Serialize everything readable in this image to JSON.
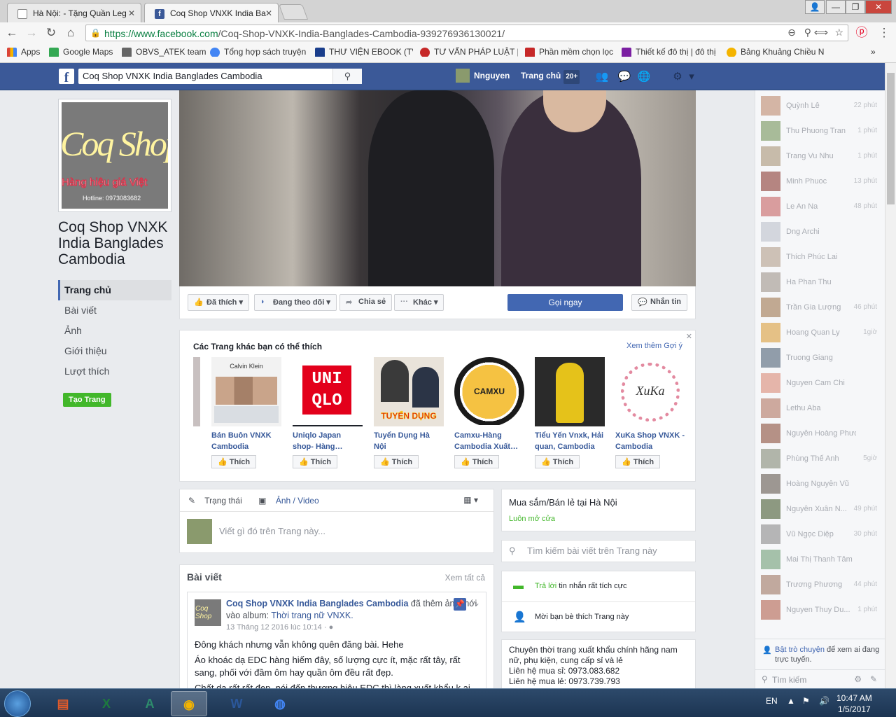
{
  "browser": {
    "tabs": [
      {
        "title": "Hà Nội: - Tặng Quần Leg"
      },
      {
        "title": "Coq Shop VNXK India Ba"
      }
    ],
    "url_host": "https://www.facebook.com",
    "url_path": "/Coq-Shop-VNXK-India-Banglades-Cambodia-939276936130021/",
    "bookmarks": [
      {
        "label": "Apps",
        "color": "#db4437"
      },
      {
        "label": "Google Maps",
        "color": "#34a853"
      },
      {
        "label": "OBVS_ATEK team",
        "color": "#666666"
      },
      {
        "label": "Tổng hợp sách truyện",
        "color": "#4285f4"
      },
      {
        "label": "THƯ VIỆN EBOOK (TV",
        "color": "#1a3e8c"
      },
      {
        "label": "TƯ VẤN PHÁP LUẬT |",
        "color": "#c62828"
      },
      {
        "label": "Phần mềm chọn lọc",
        "color": "#c62828"
      },
      {
        "label": "Thiết kế đô thị | đô thị",
        "color": "#7b1fa2"
      },
      {
        "label": "Bảng Khuảng Chiều N",
        "color": "#f4b400"
      }
    ]
  },
  "fb": {
    "search_value": "Coq Shop VNXK India Banglades Cambodia",
    "user_name": "Nnguyen",
    "home_label": "Trang chủ",
    "home_count": "20+"
  },
  "page": {
    "logo_text": "Coq Shop",
    "logo_tagline": "Hàng hiệu giá Việt",
    "logo_hotline": "Hotline: 0973083682",
    "name": "Coq Shop VNXK India Banglades Cambodia",
    "nav": [
      "Trang chủ",
      "Bài viết",
      "Ảnh",
      "Giới thiệu",
      "Lượt thích"
    ],
    "create_page": "Tạo Trang"
  },
  "actions": {
    "liked": "Đã thích",
    "following": "Đang theo dõi",
    "share": "Chia sẻ",
    "more": "Khác",
    "call": "Gọi ngay",
    "message": "Nhắn tin"
  },
  "suggest": {
    "title": "Các Trang khác bạn có thể thích",
    "more": "Xem thêm Gợi ý",
    "like_label": "Thích",
    "items": [
      {
        "name": "Bán Buôn VNXK Cambodia",
        "img_text": "Calvin Klein",
        "bg": "#f2f2f2",
        "fg": "#333333"
      },
      {
        "name": "Uniqlo Japan shop- Hàng…",
        "img_text": "UNI QLO",
        "bg": "#ffffff",
        "fg": "#ffffff"
      },
      {
        "name": "Tuyển Dụng Hà Nội",
        "img_text": "TUYỂN DỤNG",
        "bg": "#e9e3da",
        "fg": "#d81b1b"
      },
      {
        "name": "Camxu-Hàng Cambodia Xuất…",
        "img_text": "CAMXU",
        "bg": "#ffffff",
        "fg": "#222222"
      },
      {
        "name": "Tiểu Yến Vnxk, Hải quan, Cambodia",
        "img_text": "",
        "bg": "#2a2a2a",
        "fg": "#e5c21a"
      },
      {
        "name": "XuKa Shop VNXK - Cambodia",
        "img_text": "XuKa",
        "bg": "#ffffff",
        "fg": "#333333"
      }
    ]
  },
  "composer": {
    "status_tab": "Trạng thái",
    "photo_tab": "Ảnh / Video",
    "placeholder": "Viết gì đó trên Trang này..."
  },
  "posts": {
    "header": "Bài viết",
    "see_all": "Xem tất cả",
    "author": "Coq Shop VNXK India Banglades Cambodia",
    "action": " đã thêm ảnh mới vào album: ",
    "album": "Thời trang nữ VNXK.",
    "time": "13 Tháng 12 2016 lúc 10:14 · ●",
    "lines": [
      "Đông khách nhưng vẫn không quên đăng bài. Hehe",
      "Áo khoác dạ EDC hàng hiếm đây, số lượng cực ít, mặc rất tây, rất sang, phối với đầm ôm hay quần ôm đều rất đẹp.",
      "Chất dạ rất rất đẹp, nói đến thương hiệu EDC thì làng xuất khẩu k ai"
    ]
  },
  "right": {
    "category": "Mua sắm/Bán lẻ tại Hà Nội",
    "open": "Luôn mở cửa",
    "search_placeholder": "Tìm kiếm bài viết trên Trang này",
    "reply_strong": "Trả lời",
    "reply_rest": " tin nhắn rất tích cực",
    "invite": "Mời bạn bè thích Trang này",
    "about_lines": [
      "Chuyên thời trang xuất khẩu chính hãng nam nữ, phụ kiện, cung cấp sỉ và lẻ",
      "Liên hệ mua sỉ: 0973.083.682",
      "Liên hệ mua lẻ: 0973.739.793"
    ]
  },
  "chat": {
    "friends": [
      {
        "name": "Quỳnh Lê",
        "time": "22 phút",
        "color": "#c9a08a"
      },
      {
        "name": "Thu Phuong Tran",
        "time": "1 phút",
        "color": "#8fa87a"
      },
      {
        "name": "Trang Vu Nhu",
        "time": "1 phút",
        "color": "#b8a890"
      },
      {
        "name": "Minh Phuoc",
        "time": "13 phút",
        "color": "#a0605a"
      },
      {
        "name": "Le An Na",
        "time": "48 phút",
        "color": "#d08080"
      },
      {
        "name": "Dng Archi",
        "time": "",
        "color": "#c8ccd4"
      },
      {
        "name": "Thích Phúc Lai",
        "time": "",
        "color": "#c0b0a0"
      },
      {
        "name": "Ha Phan Thu",
        "time": "",
        "color": "#b0a8a0"
      },
      {
        "name": "Trần Gia Lượng",
        "time": "46 phút",
        "color": "#b09070"
      },
      {
        "name": "Hoang Quan Ly",
        "time": "1giờ",
        "color": "#e0b060"
      },
      {
        "name": "Truong Giang",
        "time": "",
        "color": "#708090"
      },
      {
        "name": "Nguyen Cam Chi",
        "time": "",
        "color": "#e0a090"
      },
      {
        "name": "Lethu Aba",
        "time": "",
        "color": "#c09080"
      },
      {
        "name": "Nguyễn Hoàng Phương",
        "time": "",
        "color": "#a07060"
      },
      {
        "name": "Phùng Thế Anh",
        "time": "5giờ",
        "color": "#9aa090"
      },
      {
        "name": "Hoàng Nguyên Vũ",
        "time": "",
        "color": "#807870"
      },
      {
        "name": "Nguyễn Xuân N...",
        "time": "49 phút",
        "color": "#6a7a5a"
      },
      {
        "name": "Vũ Ngọc Diệp",
        "time": "30 phút",
        "color": "#a0a0a0"
      },
      {
        "name": "Mai Thị Thanh Tâm",
        "time": "",
        "color": "#8ab090"
      },
      {
        "name": "Trương Phương",
        "time": "44 phút",
        "color": "#b09080"
      },
      {
        "name": "Nguyen Thuy Du...",
        "time": "1 phút",
        "color": "#c08070"
      }
    ],
    "enable_link": "Bật trò chuyện",
    "enable_rest": " để xem ai đang trực tuyến.",
    "search": "Tìm kiếm"
  },
  "taskbar": {
    "lang": "EN",
    "time": "10:47 AM",
    "date": "1/5/2017"
  }
}
